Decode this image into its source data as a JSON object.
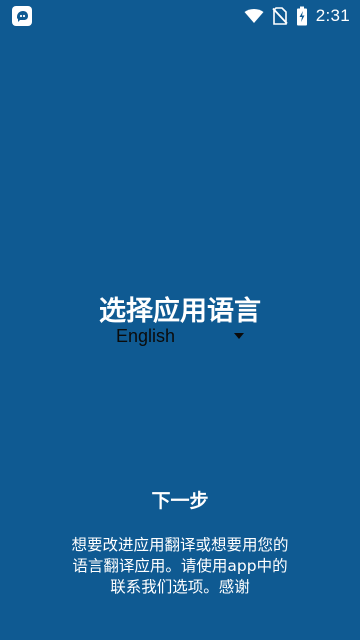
{
  "colors": {
    "background": "#0f5a92",
    "text": "#ffffff",
    "dropdown_text": "#0b0b0b"
  },
  "status_bar": {
    "time": "2:31",
    "icons": [
      "app-notification-icon",
      "wifi-icon",
      "no-sim-icon",
      "battery-charging-icon"
    ]
  },
  "screen": {
    "title": "选择应用语言",
    "language_select": {
      "selected": "English",
      "icon": "dropdown-arrow-icon"
    },
    "next_button": "下一步",
    "description_lines": [
      "想要改进应用翻译或想要用您的",
      "语言翻译应用。请使用app中的",
      "联系我们选项。感谢"
    ]
  }
}
